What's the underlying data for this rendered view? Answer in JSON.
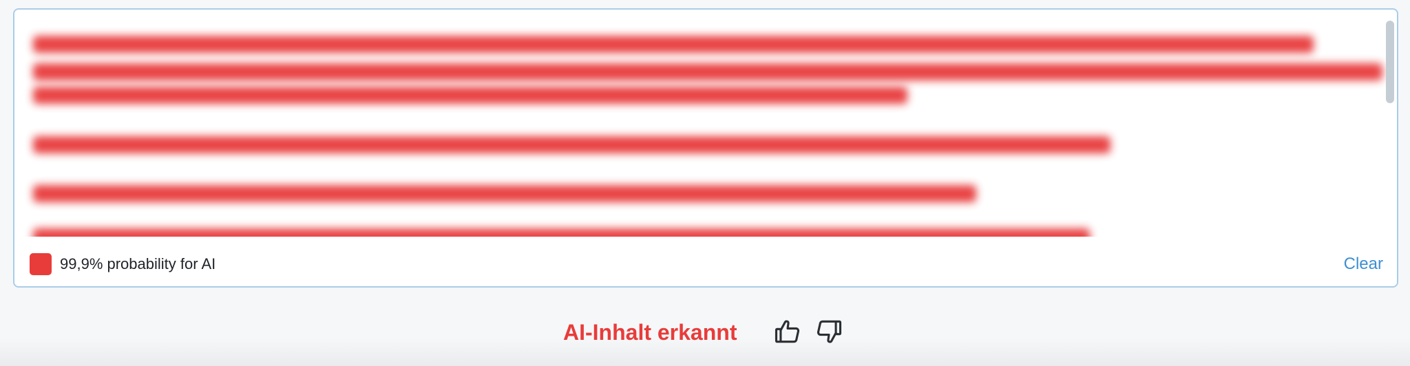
{
  "detector": {
    "probability_text": "99,9% probability for AI",
    "clear_label": "Clear",
    "indicator_color": "#e83c3a"
  },
  "result": {
    "label": "AI-Inhalt erkannt",
    "label_color": "#e83c3a",
    "thumbs_up_icon": "thumbs-up-icon",
    "thumbs_down_icon": "thumbs-down-icon"
  }
}
